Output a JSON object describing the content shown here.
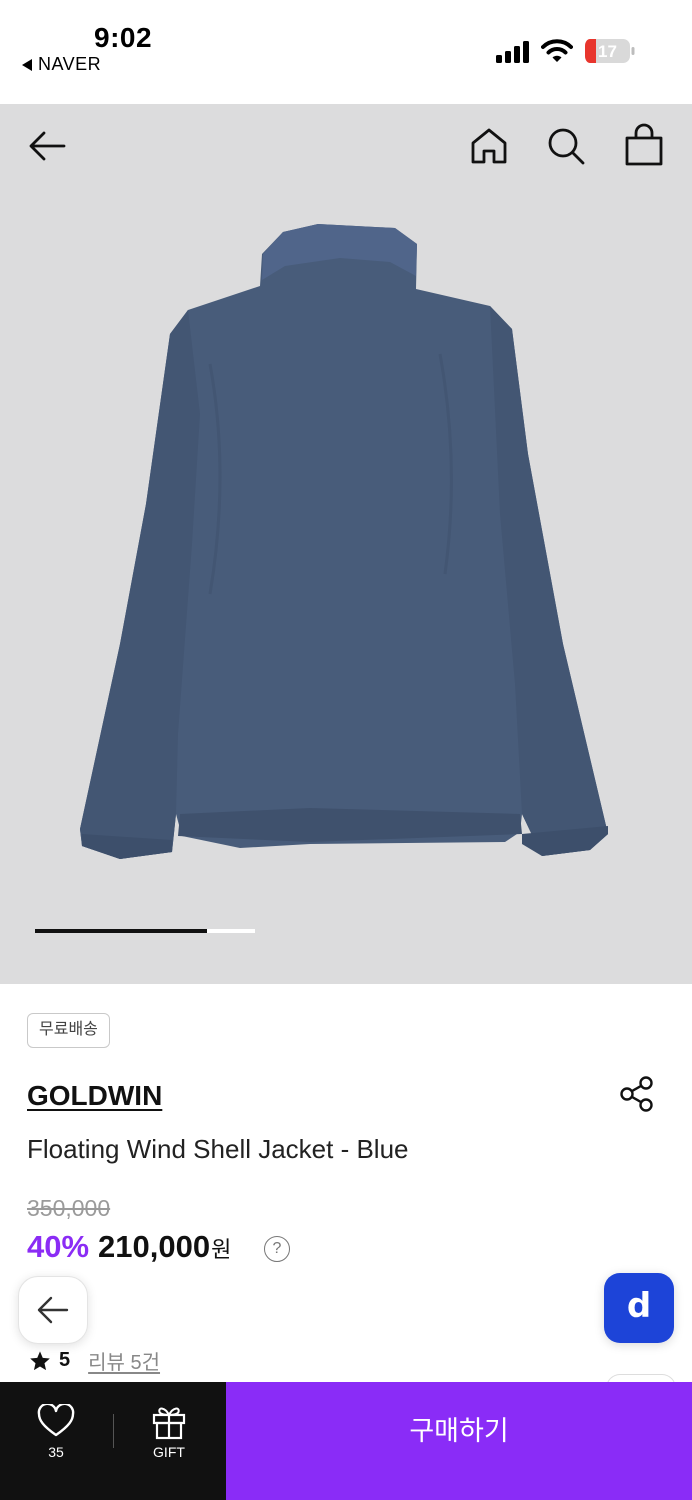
{
  "status_bar": {
    "time": "9:02",
    "back_app": "NAVER",
    "battery": "17"
  },
  "nav": {
    "icons": [
      "back-arrow-icon",
      "home-icon",
      "search-icon",
      "shopping-bag-icon"
    ]
  },
  "carousel": {
    "image_description_icon": "jacket-image",
    "progress": 0.78
  },
  "product": {
    "badge": "무료배송",
    "brand": "GOLDWIN",
    "name": "Floating Wind Shell Jacket - Blue",
    "original_price": "350,000",
    "discount": "40%",
    "price": "210,000",
    "currency": "원",
    "info_icon_glyph": "?",
    "rating": "5",
    "reviews": "리뷰 5건"
  },
  "floating": {
    "d_button_label": "d"
  },
  "bottom_bar": {
    "like_count": "35",
    "gift_label": "GIFT",
    "buy_label": "구매하기"
  },
  "colors": {
    "accent": "#8a2cf7",
    "discount": "#8b2cf5",
    "hero_bg": "#dcdcdd",
    "jacket": "#485c7a",
    "d_button": "#1d44d8"
  }
}
